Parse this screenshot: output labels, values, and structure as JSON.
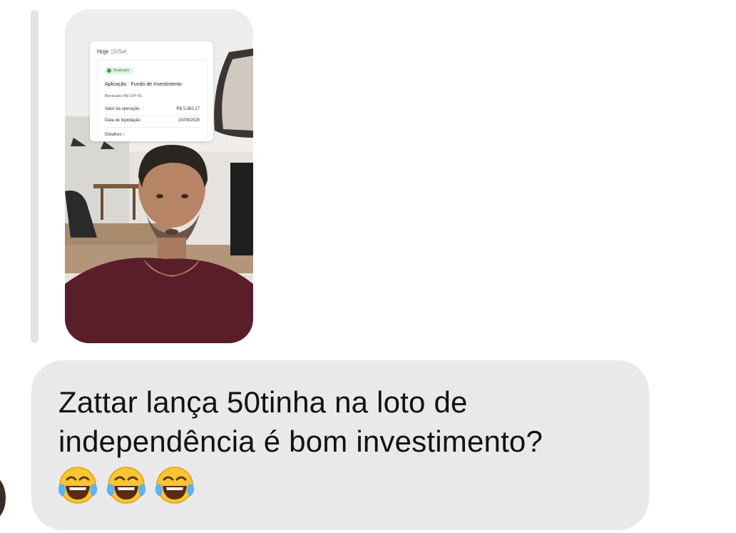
{
  "story_reply": {
    "card": {
      "day_label": "Hoje",
      "date_label": "15/Set",
      "status_badge": "Realizado",
      "operation_type": "Aplicação · Fundo de Investimento",
      "fund_name": "Barracuda FIM CrPr RL",
      "rows": [
        {
          "label": "Valor da operação",
          "value": "R$ 5.382,17"
        },
        {
          "label": "Data de liquidação",
          "value": "15/09/2026"
        }
      ],
      "details_link": "Detalhes ›"
    }
  },
  "message": {
    "text": "Zattar lança 50tinha na loto de independência é bom investimento?",
    "emojis": [
      "face-with-tears-of-joy",
      "face-with-tears-of-joy",
      "face-with-tears-of-joy"
    ]
  },
  "colors": {
    "bubble": "#e9e9eb",
    "reply_bar": "#e3e3e6",
    "text": "#111111"
  }
}
